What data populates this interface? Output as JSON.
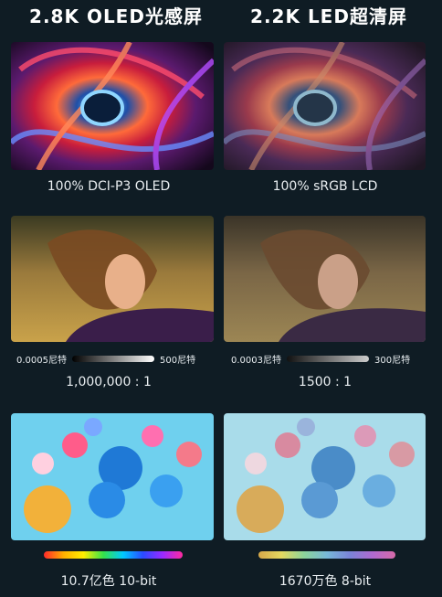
{
  "left": {
    "title": "2.8K OLED光感屏",
    "gamut_label": "100% DCI-P3 OLED",
    "brightness_min": "0.0005尼特",
    "brightness_max": "500尼特",
    "contrast": "1,000,000 : 1",
    "color_depth": "10.7亿色  10-bit"
  },
  "right": {
    "title": "2.2K LED超清屏",
    "gamut_label": "100% sRGB LCD",
    "brightness_min": "0.0003尼特",
    "brightness_max": "300尼特",
    "contrast": "1500 : 1",
    "color_depth": "1670万色  8-bit"
  }
}
